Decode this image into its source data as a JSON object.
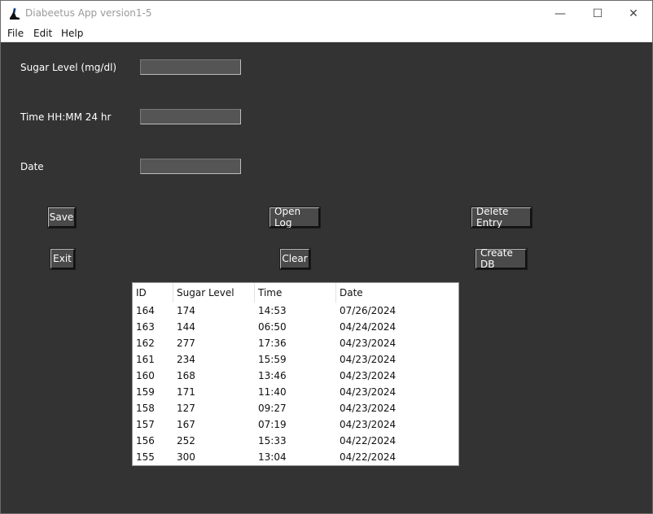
{
  "window": {
    "title": "Diabeetus App version1-5",
    "minimize_glyph": "—",
    "maximize_glyph": "☐",
    "close_glyph": "✕"
  },
  "menu": [
    "File",
    "Edit",
    "Help"
  ],
  "form": {
    "sugar_label": "Sugar Level (mg/dl)",
    "time_label": "Time HH:MM 24 hr",
    "date_label": "Date",
    "sugar_value": "",
    "time_value": "",
    "date_value": ""
  },
  "buttons": {
    "save": "Save",
    "open_log": "Open Log",
    "delete_entry": "Delete Entry",
    "exit": "Exit",
    "clear": "Clear",
    "create_db": "Create DB"
  },
  "table": {
    "columns": [
      "ID",
      "Sugar Level",
      "Time",
      "Date"
    ],
    "rows": [
      [
        "164",
        "174",
        "14:53",
        "07/26/2024"
      ],
      [
        "163",
        "144",
        "06:50",
        "04/24/2024"
      ],
      [
        "162",
        "277",
        "17:36",
        "04/23/2024"
      ],
      [
        "161",
        "234",
        "15:59",
        "04/23/2024"
      ],
      [
        "160",
        "168",
        "13:46",
        "04/23/2024"
      ],
      [
        "159",
        "171",
        "11:40",
        "04/23/2024"
      ],
      [
        "158",
        "127",
        "09:27",
        "04/23/2024"
      ],
      [
        "157",
        "167",
        "07:19",
        "04/23/2024"
      ],
      [
        "156",
        "252",
        "15:33",
        "04/22/2024"
      ],
      [
        "155",
        "300",
        "13:04",
        "04/22/2024"
      ]
    ]
  },
  "colors": {
    "background": "#333333",
    "entry_fill": "#555555",
    "button_fill": "#4a4a4a",
    "text_light": "#ffffff"
  }
}
